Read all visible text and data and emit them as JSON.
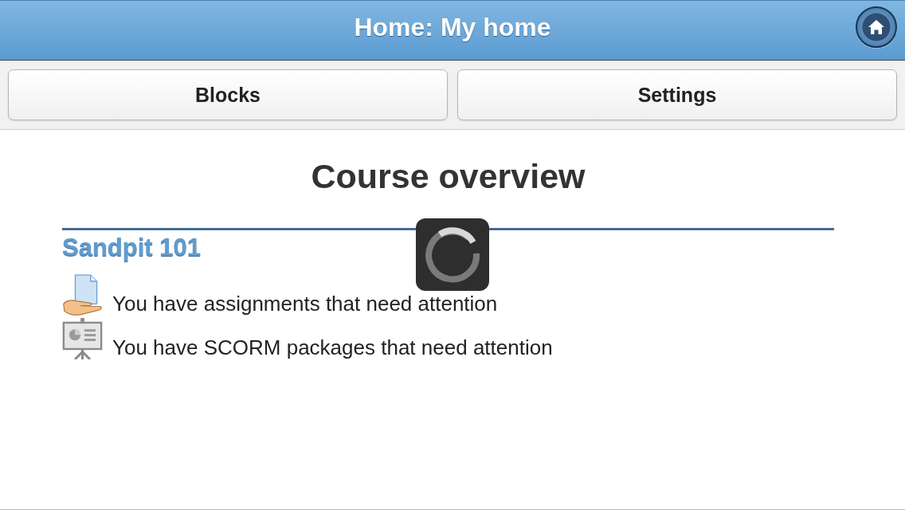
{
  "header": {
    "title": "Home: My home"
  },
  "toolbar": {
    "buttons": [
      "Blocks",
      "Settings"
    ]
  },
  "main": {
    "heading": "Course overview",
    "courses": [
      {
        "name": "Sandpit 101",
        "notices": [
          {
            "kind": "assignment",
            "text": "You have assignments that need attention"
          },
          {
            "kind": "scorm",
            "text": "You have SCORM packages that need attention"
          }
        ]
      }
    ]
  },
  "loading": true
}
